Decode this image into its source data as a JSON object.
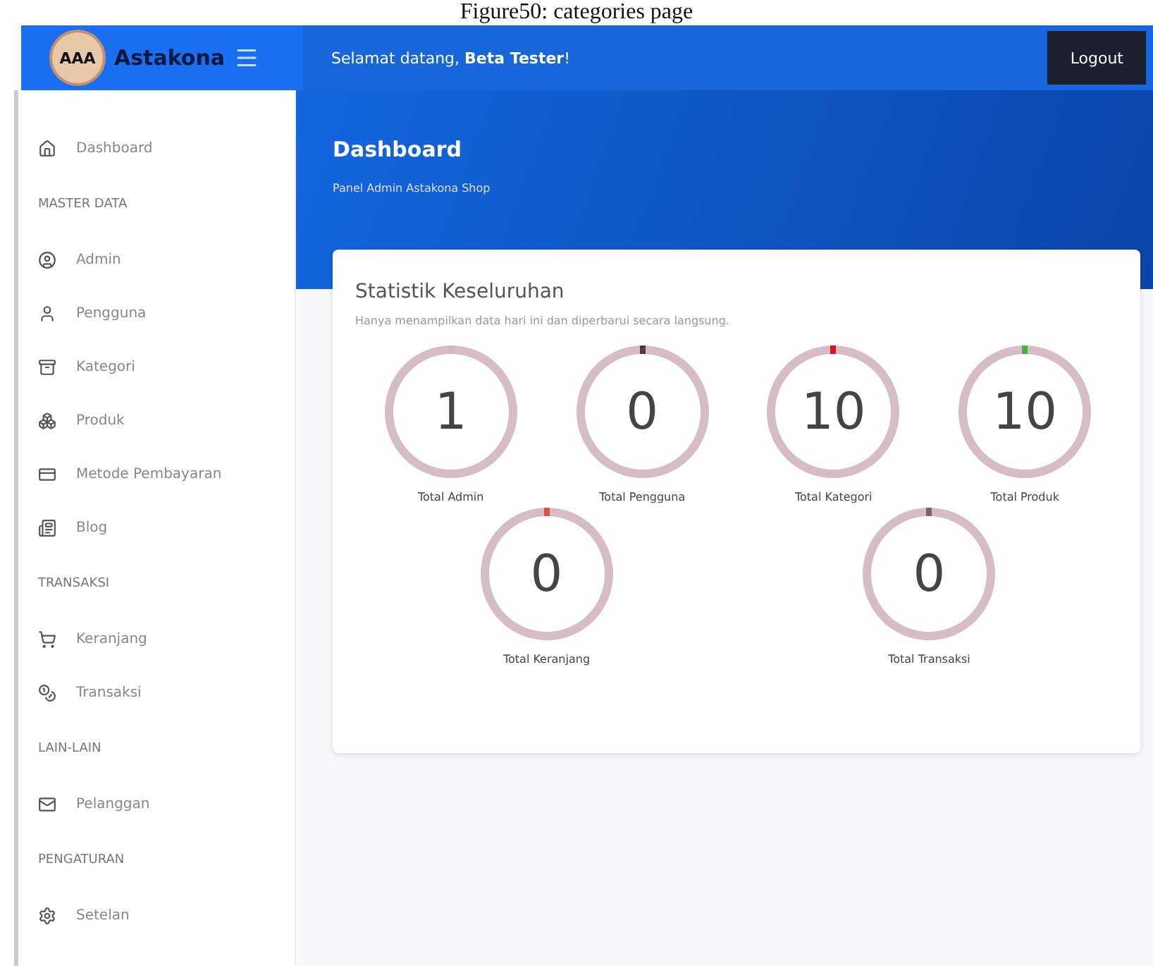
{
  "caption": "Figure50: categories page",
  "navbar": {
    "logo_text": "AAA",
    "brand": "Astakona",
    "greeting": "Selamat datang, **Beta Tester**!",
    "logout": "Logout"
  },
  "sidebar": {
    "items": [
      {
        "kind": "link",
        "label": "Dashboard"
      },
      {
        "kind": "heading",
        "label": "MASTER DATA"
      },
      {
        "kind": "link",
        "label": "Admin"
      },
      {
        "kind": "link",
        "label": "Pengguna"
      },
      {
        "kind": "link",
        "label": "Kategori"
      },
      {
        "kind": "link",
        "label": "Produk"
      },
      {
        "kind": "link",
        "label": "Metode Pembayaran"
      },
      {
        "kind": "link",
        "label": "Blog"
      },
      {
        "kind": "heading",
        "label": "TRANSAKSI"
      },
      {
        "kind": "link",
        "label": "Keranjang"
      },
      {
        "kind": "link",
        "label": "Transaksi"
      },
      {
        "kind": "heading",
        "label": "LAIN-LAIN"
      },
      {
        "kind": "link",
        "label": "Pelanggan"
      },
      {
        "kind": "heading",
        "label": "PENGATURAN"
      },
      {
        "kind": "link",
        "label": "Setelan"
      }
    ]
  },
  "header": {
    "title": "Dashboard",
    "subtitle": "Panel Admin Astakona Shop"
  },
  "card": {
    "title": "Statistik Keseluruhan",
    "note": "Hanya menampilkan data hari ini dan diperbarui secara langsung.",
    "stats": [
      {
        "value": "1",
        "label": "Total Admin",
        "color": "#c8b8c0"
      },
      {
        "value": "0",
        "label": "Total Pengguna",
        "color": "#503848"
      },
      {
        "value": "10",
        "label": "Total Kategori",
        "color": "#e01020"
      },
      {
        "value": "10",
        "label": "Total Produk",
        "color": "#40b040"
      },
      {
        "value": "0",
        "label": "Total Keranjang",
        "color": "#e05040"
      },
      {
        "value": "0",
        "label": "Total Transaksi",
        "color": "#806070"
      }
    ]
  }
}
